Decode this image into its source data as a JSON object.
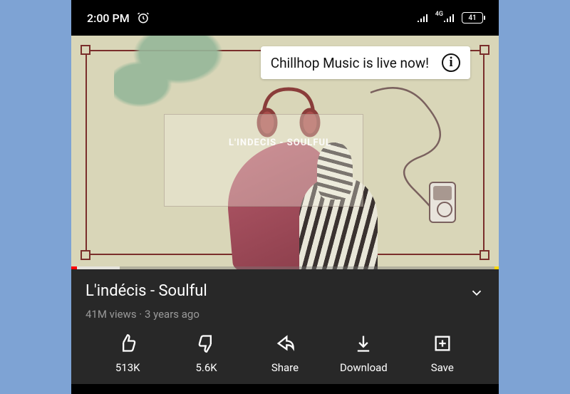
{
  "status": {
    "time": "2:00 PM",
    "network_label": "4G",
    "battery_pct": "41"
  },
  "live_banner": {
    "text": "Chillhop Music is live now!"
  },
  "overlay": {
    "title": "L'INDECIS - SOULFUL"
  },
  "video": {
    "title": "L'indécis - Soulful",
    "views": "41M views",
    "separator": " · ",
    "age": "3 years ago"
  },
  "actions": {
    "like": "513K",
    "dislike": "5.6K",
    "share": "Share",
    "download": "Download",
    "save": "Save"
  }
}
